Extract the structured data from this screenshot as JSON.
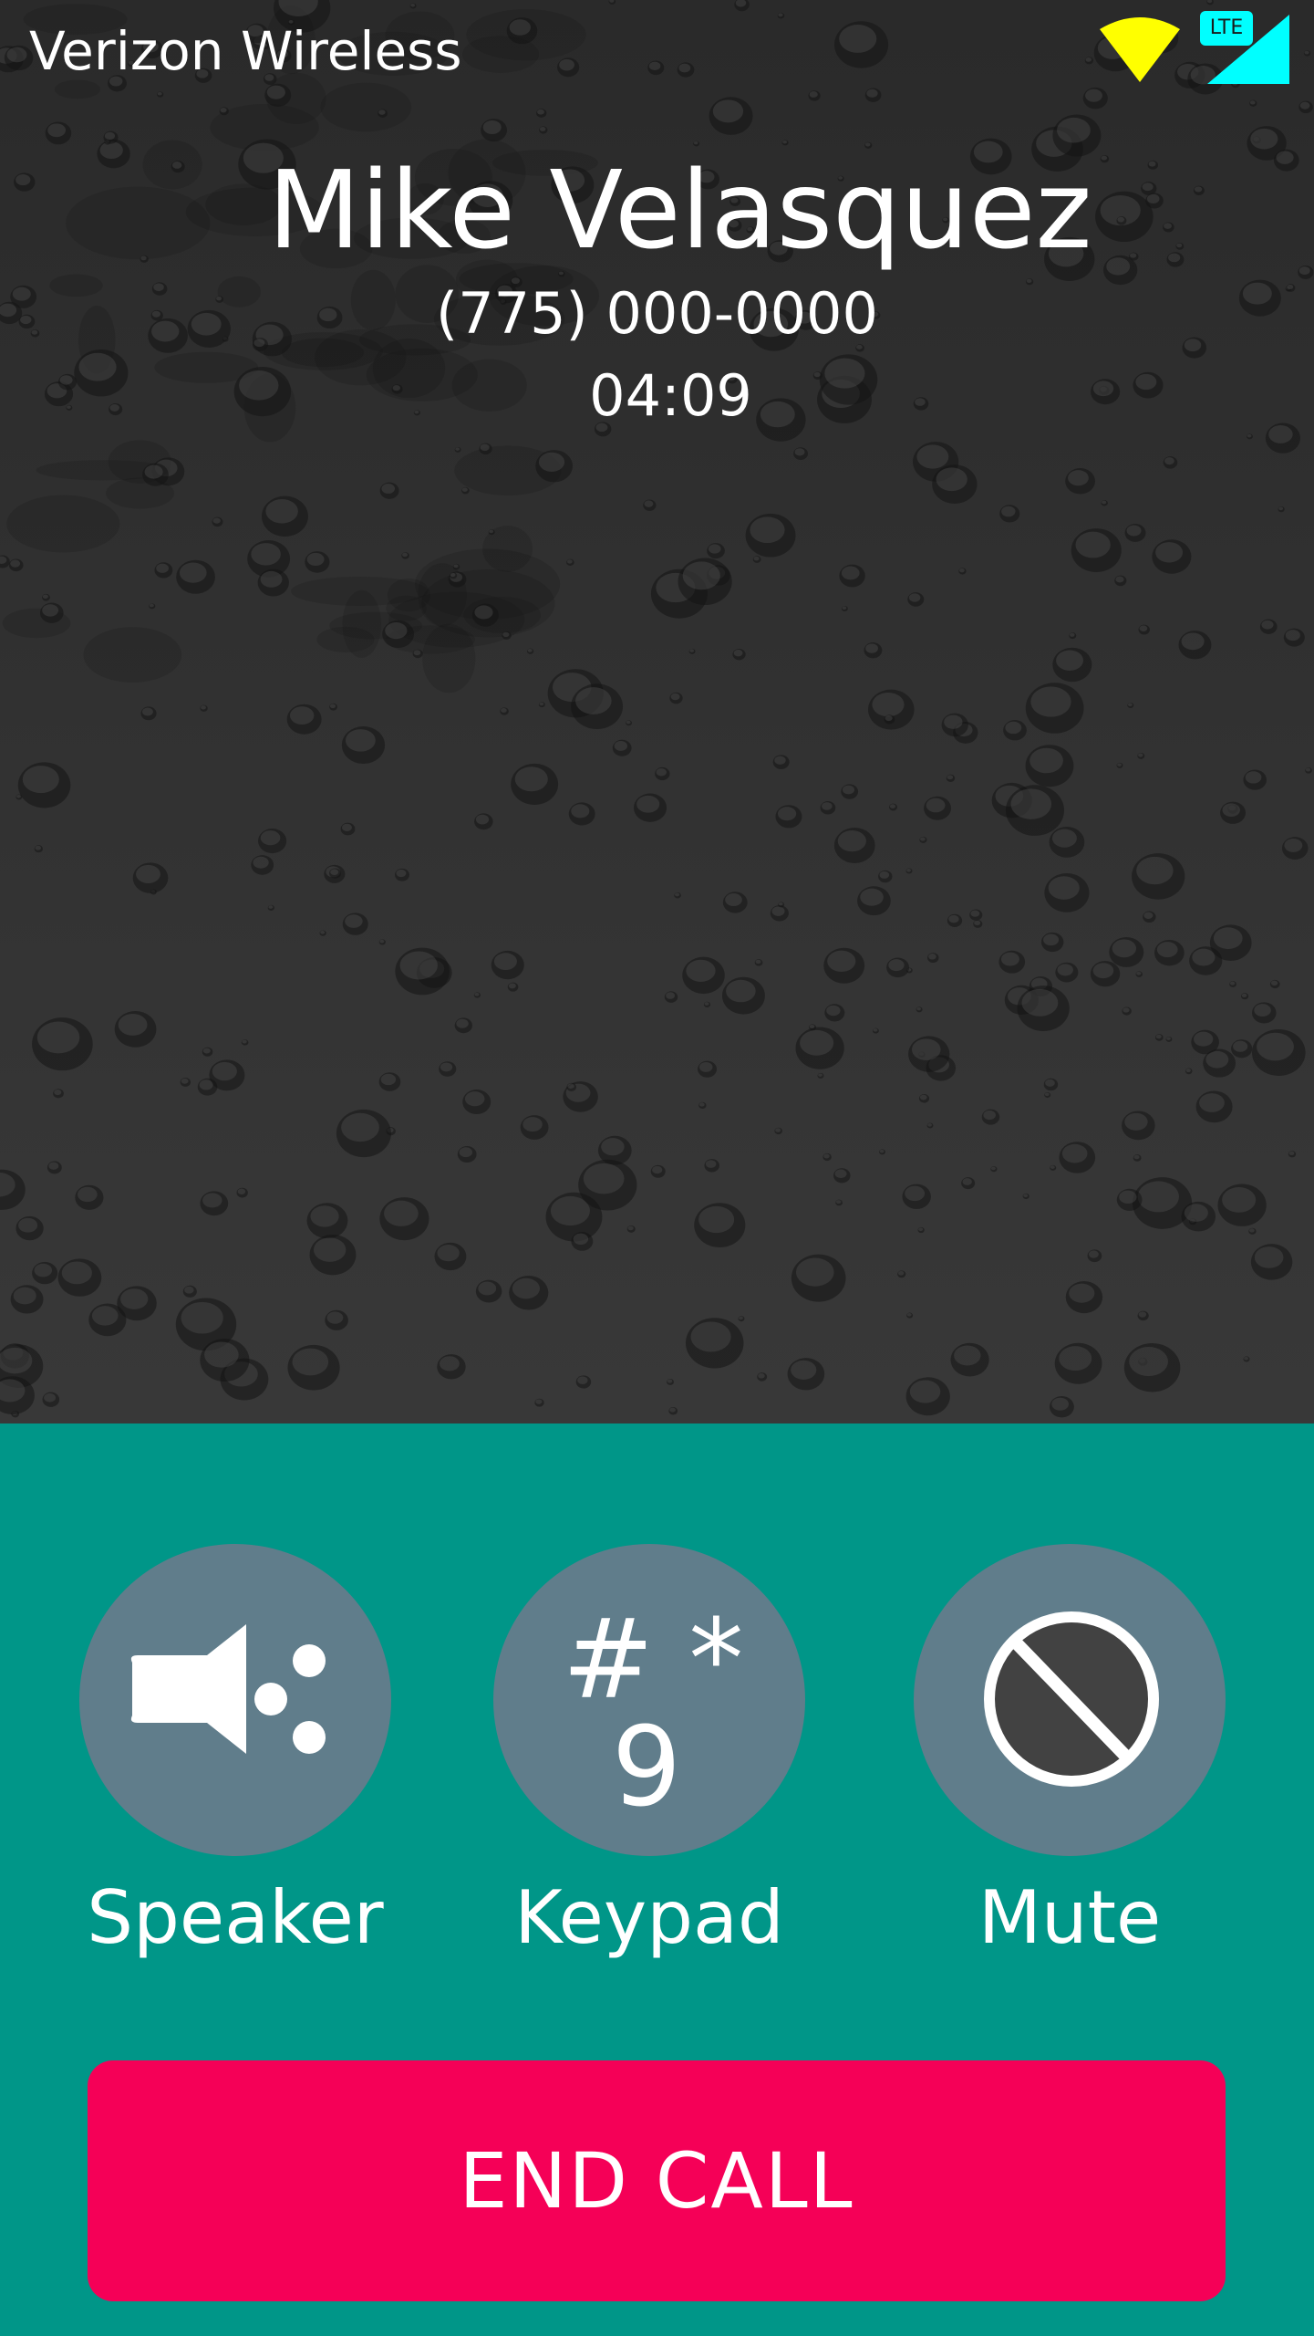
{
  "status_bar": {
    "carrier": "Verizon Wireless",
    "network_badge": "LTE",
    "wifi_icon": "wifi-icon",
    "signal_icon": "cell-signal-icon",
    "wifi_color": "#ffff00",
    "signal_color": "#00ffff"
  },
  "call": {
    "caller_name": "Mike Velasquez",
    "caller_number": "(775) 000-0000",
    "duration": "04:09"
  },
  "controls": {
    "speaker": {
      "label": "Speaker",
      "icon": "speaker-icon"
    },
    "keypad": {
      "label": "Keypad",
      "icon": "keypad-icon",
      "glyph_top": "# *",
      "glyph_bottom": "9"
    },
    "mute": {
      "label": "Mute",
      "icon": "mute-icon"
    }
  },
  "end_call": {
    "label": "END CALL"
  },
  "colors": {
    "panel": "#009688",
    "button_circle": "#607d8b",
    "end_call": "#f50057"
  }
}
